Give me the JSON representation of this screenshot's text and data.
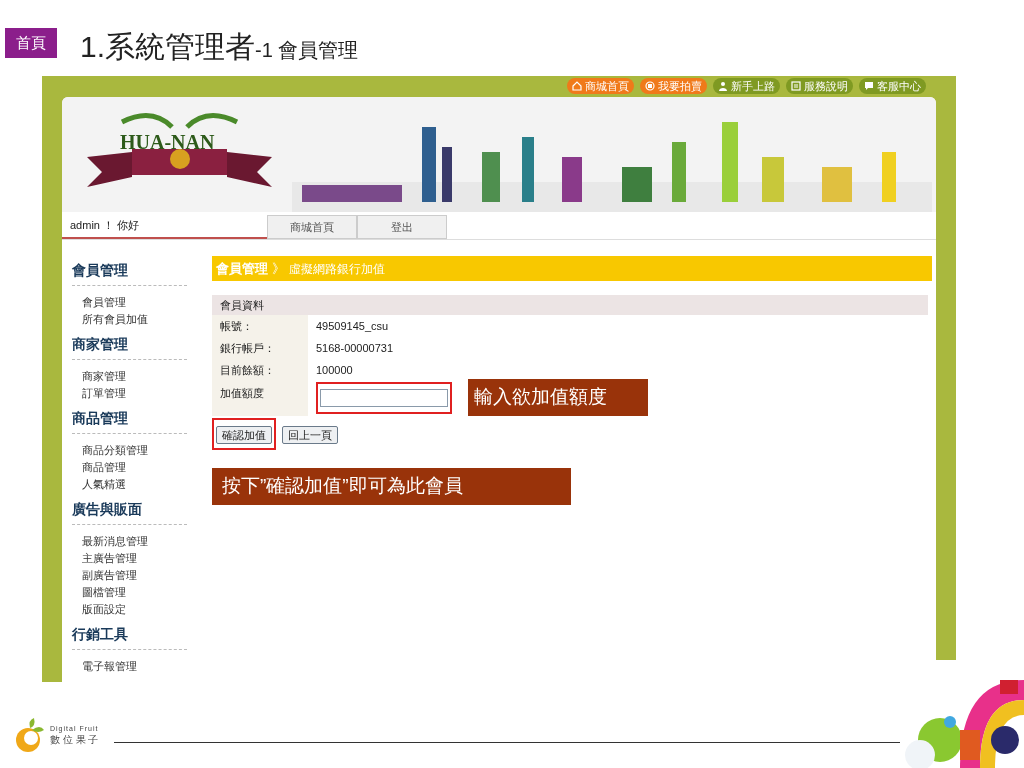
{
  "slide": {
    "home_button": "首頁",
    "title": "1.系統管理者",
    "title_suffix": "-1 會員管理"
  },
  "screenshot": {
    "top_links": [
      {
        "label": "商城首頁",
        "color": "#f07a1a"
      },
      {
        "label": "我要拍賣",
        "color": "#f07a1a"
      },
      {
        "label": "新手上路",
        "color": "#7f9a22"
      },
      {
        "label": "服務說明",
        "color": "#7f9a22"
      },
      {
        "label": "客服中心",
        "color": "#7f9a22"
      }
    ],
    "logo": "HUA-NAN",
    "greeting": "admin ！ 你好",
    "nav_tabs": [
      "商城首頁",
      "登出"
    ],
    "sidebar": [
      {
        "heading": "會員管理",
        "items": [
          "會員管理",
          "所有會員加值"
        ]
      },
      {
        "heading": "商家管理",
        "items": [
          "商家管理",
          "訂單管理"
        ]
      },
      {
        "heading": "商品管理",
        "items": [
          "商品分類管理",
          "商品管理",
          "人氣精選"
        ]
      },
      {
        "heading": "廣告與販面",
        "items": [
          "最新消息管理",
          "主廣告管理",
          "副廣告管理",
          "圖檔管理",
          "版面設定"
        ]
      },
      {
        "heading": "行銷工具",
        "items": [
          "電子報管理"
        ]
      }
    ],
    "breadcrumb": {
      "section": "會員管理",
      "separator": "》",
      "page": "虛擬網路銀行加值"
    },
    "form": {
      "title": "會員資料",
      "rows": [
        {
          "label": "帳號：",
          "value": "49509145_csu"
        },
        {
          "label": "銀行帳戶：",
          "value": "5168-00000731"
        },
        {
          "label": "目前餘額：",
          "value": "100000"
        }
      ],
      "amount": {
        "label": "加值額度",
        "highlighted": true
      },
      "buttons": [
        {
          "label": "確認加值",
          "highlighted": true
        },
        {
          "label": "回上一頁",
          "highlighted": false
        }
      ]
    },
    "callouts": [
      "輸入欲加值額度",
      "按下”確認加值”即可為此會員"
    ]
  },
  "footer": {
    "brand": "Digital Fruit",
    "brand_sub": "數 位 果 子"
  }
}
